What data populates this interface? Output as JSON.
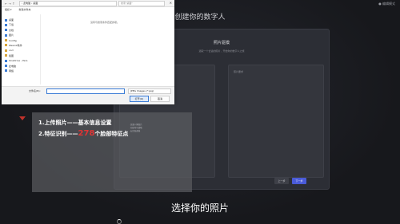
{
  "app": {
    "title": "创建你的数字人",
    "top_right": "● 编辑模式"
  },
  "photo_dialog": {
    "title": "照片驱模",
    "subtitle": "选取一个合适的照片，开始你的数字人之旅",
    "right_hint": "照片要求",
    "prev_button": "上一步",
    "next_button": "下一步"
  },
  "tutorial": {
    "line1": "1.上传照片——基本信息设置",
    "line2_prefix": "2.特征识别——",
    "line2_number": "278",
    "line2_suffix": "个脸部特征点",
    "side_notes": [
      "·正面人像照片",
      "·光线均匀清晰",
      "·五官无遮挡"
    ]
  },
  "caption": "选择你的照片",
  "file_dialog": {
    "path": "› 此电脑 › 桌面",
    "search_placeholder": "搜索\"桌面\"",
    "cmd": [
      "组织 ▾",
      "新建文件夹"
    ],
    "sidebar": [
      {
        "label": "桌面",
        "color": "blue"
      },
      {
        "label": "下载",
        "color": "blue"
      },
      {
        "label": "文档",
        "color": "blue"
      },
      {
        "label": "图片",
        "color": "blue"
      },
      {
        "label": "Config",
        "color": "yellow"
      },
      {
        "label": "WeLink软件",
        "color": "yellow"
      },
      {
        "label": "vod",
        "color": "yellow"
      },
      {
        "label": "截图",
        "color": "yellow"
      },
      {
        "label": "OneDrive - Pers",
        "color": "blue"
      },
      {
        "label": "此电脑",
        "color": "blue"
      },
      {
        "label": "网络",
        "color": "blue"
      }
    ],
    "empty_text": "没有与搜索条件匹配的项。",
    "filename_label": "文件名(N):",
    "filename_value": "",
    "filetype": "JPEG Images (*.jpg)",
    "open_button": "打开(O)",
    "cancel_button": "取消"
  }
}
